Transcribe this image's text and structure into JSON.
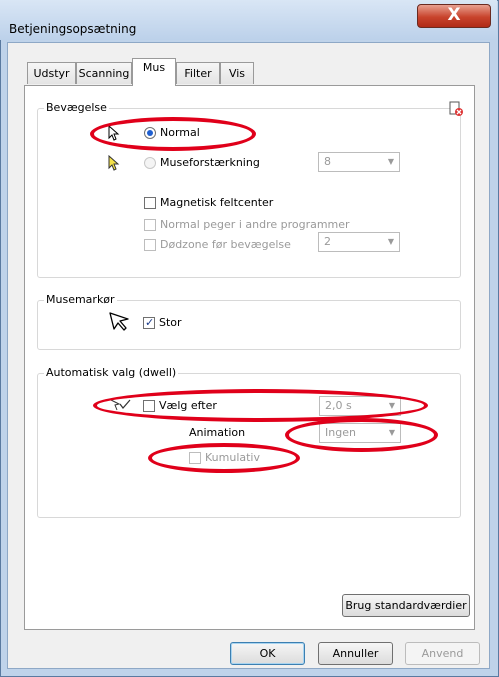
{
  "window": {
    "title": "Betjeningsopsætning",
    "close_glyph": "X"
  },
  "tabs": [
    {
      "label": "Udstyr",
      "active": false
    },
    {
      "label": "Scanning",
      "active": false
    },
    {
      "label": "Mus",
      "active": true
    },
    {
      "label": "Filter",
      "active": false
    },
    {
      "label": "Vis",
      "active": false
    }
  ],
  "bevaegelse": {
    "title": "Bevægelse",
    "normal_label": "Normal",
    "normal_selected": true,
    "amplify_label": "Museforstærkning",
    "amplify_value": "8",
    "magnetic_label": "Magnetisk feltcenter",
    "normal_other_label": "Normal peger i andre programmer",
    "deadzone_label": "Dødzone før bevægelse",
    "deadzone_value": "2",
    "reset_icon": "cursor-reset-icon"
  },
  "musemarkor": {
    "title": "Musemarkør",
    "large_label": "Stor",
    "large_checked": true
  },
  "dwell": {
    "title": "Automatisk valg (dwell)",
    "select_after_label": "Vælg efter",
    "select_after_value": "2,0 s",
    "animation_label": "Animation",
    "animation_value": "Ingen",
    "cumulative_label": "Kumulativ"
  },
  "buttons": {
    "defaults": "Brug standardværdier",
    "ok": "OK",
    "cancel": "Annuller",
    "apply": "Anvend"
  },
  "colors": {
    "annotation": "#e0001a",
    "accent": "#1f5fd0"
  }
}
